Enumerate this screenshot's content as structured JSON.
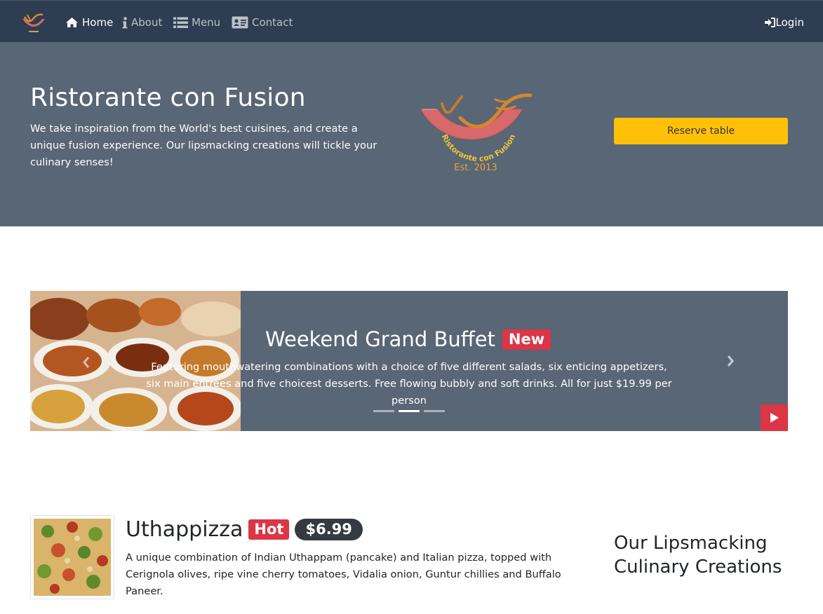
{
  "nav": {
    "brand_icon": "restaurant-logo",
    "items": [
      {
        "label": "Home",
        "icon": "home-icon",
        "active": true
      },
      {
        "label": "About",
        "icon": "info-icon",
        "active": false
      },
      {
        "label": "Menu",
        "icon": "list-icon",
        "active": false
      },
      {
        "label": "Contact",
        "icon": "address-card-icon",
        "active": false
      }
    ],
    "login_label": "Login",
    "login_icon": "sign-in-icon"
  },
  "jumbotron": {
    "title": "Ristorante con Fusion",
    "description": "We take inspiration from the World's best cuisines, and create a unique fusion experience. Our lipsmacking creations will tickle your culinary senses!",
    "logo_text": "Ristorante con Fusion",
    "logo_est": "Est. 2013",
    "reserve_label": "Reserve table"
  },
  "carousel": {
    "title": "Weekend Grand Buffet",
    "badge": "New",
    "text": "Featuring mouthwatering combinations with a choice of five different salads, six enticing appetizers, six main entrees and five choicest desserts. Free flowing bubbly and soft drinks. All for just $19.99 per person",
    "indicators": 3,
    "active_indicator": 1
  },
  "featured_dish": {
    "name": "Uthappizza",
    "badge": "Hot",
    "price": "$6.99",
    "description": "A unique combination of Indian Uthappam (pancake) and Italian pizza, topped with Cerignola olives, ripe vine cherry tomatoes, Vidalia onion, Guntur chillies and Buffalo Paneer."
  },
  "side_heading": "Our Lipsmacking Culinary Creations",
  "colors": {
    "navbar": "#2e3d51",
    "jumbotron": "#586675",
    "reserve_button": "#ffc107",
    "badge_red": "#dc3545",
    "badge_dark": "#343a40"
  }
}
